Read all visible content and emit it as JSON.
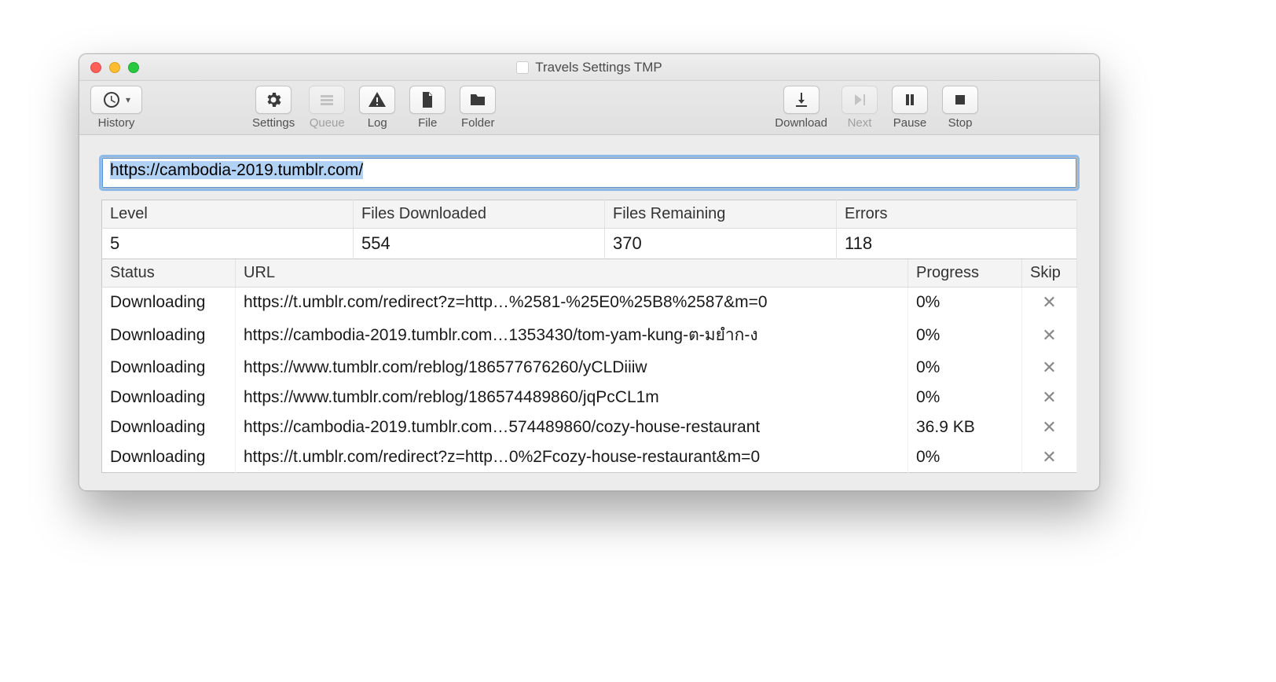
{
  "window": {
    "title": "Travels Settings TMP"
  },
  "toolbar": {
    "history": "History",
    "settings": "Settings",
    "queue": "Queue",
    "log": "Log",
    "file": "File",
    "folder": "Folder",
    "download": "Download",
    "next": "Next",
    "pause": "Pause",
    "stop": "Stop"
  },
  "url": {
    "value": "https://cambodia-2019.tumblr.com/"
  },
  "stats": {
    "headers": {
      "level": "Level",
      "files_downloaded": "Files Downloaded",
      "files_remaining": "Files Remaining",
      "errors": "Errors"
    },
    "values": {
      "level": "5",
      "files_downloaded": "554",
      "files_remaining": "370",
      "errors": "118"
    }
  },
  "columns": {
    "status": "Status",
    "url": "URL",
    "progress": "Progress",
    "skip": "Skip"
  },
  "downloads": [
    {
      "status": "Downloading",
      "url": "https://t.umblr.com/redirect?z=http…%2581-%25E0%25B8%2587&m=0",
      "progress": "0%"
    },
    {
      "status": "Downloading",
      "url": "https://cambodia-2019.tumblr.com…1353430/tom-yam-kung-ต-มยำก-ง",
      "progress": "0%"
    },
    {
      "status": "Downloading",
      "url": "https://www.tumblr.com/reblog/186577676260/yCLDiiiw",
      "progress": "0%"
    },
    {
      "status": "Downloading",
      "url": "https://www.tumblr.com/reblog/186574489860/jqPcCL1m",
      "progress": "0%"
    },
    {
      "status": "Downloading",
      "url": "https://cambodia-2019.tumblr.com…574489860/cozy-house-restaurant",
      "progress": "36.9 KB"
    },
    {
      "status": "Downloading",
      "url": "https://t.umblr.com/redirect?z=http…0%2Fcozy-house-restaurant&m=0",
      "progress": "0%"
    }
  ]
}
